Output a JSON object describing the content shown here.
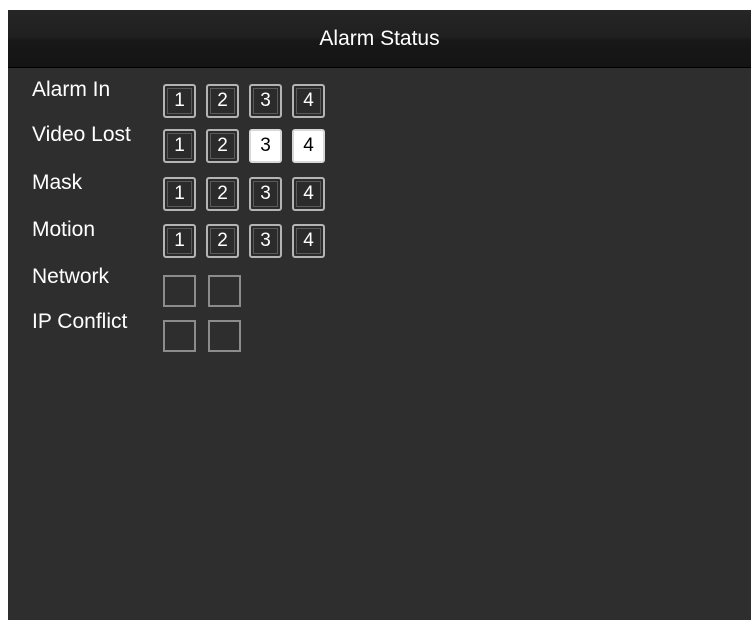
{
  "window": {
    "title": "Alarm Status"
  },
  "rows": [
    {
      "label": "Alarm In",
      "cells": [
        "1",
        "2",
        "3",
        "4"
      ],
      "active": [
        false,
        false,
        false,
        false
      ]
    },
    {
      "label": "Video Lost",
      "cells": [
        "1",
        "2",
        "3",
        "4"
      ],
      "active": [
        false,
        false,
        true,
        true
      ]
    },
    {
      "label": "Mask",
      "cells": [
        "1",
        "2",
        "3",
        "4"
      ],
      "active": [
        false,
        false,
        false,
        false
      ]
    },
    {
      "label": "Motion",
      "cells": [
        "1",
        "2",
        "3",
        "4"
      ],
      "active": [
        false,
        false,
        false,
        false
      ]
    }
  ],
  "network": {
    "label": "Network"
  },
  "ip_conflict": {
    "label": "IP Conflict"
  },
  "colors": {
    "background": "#2e2e2e",
    "active_cell": "#ffffff",
    "cell_border": "#b4b4b4"
  }
}
